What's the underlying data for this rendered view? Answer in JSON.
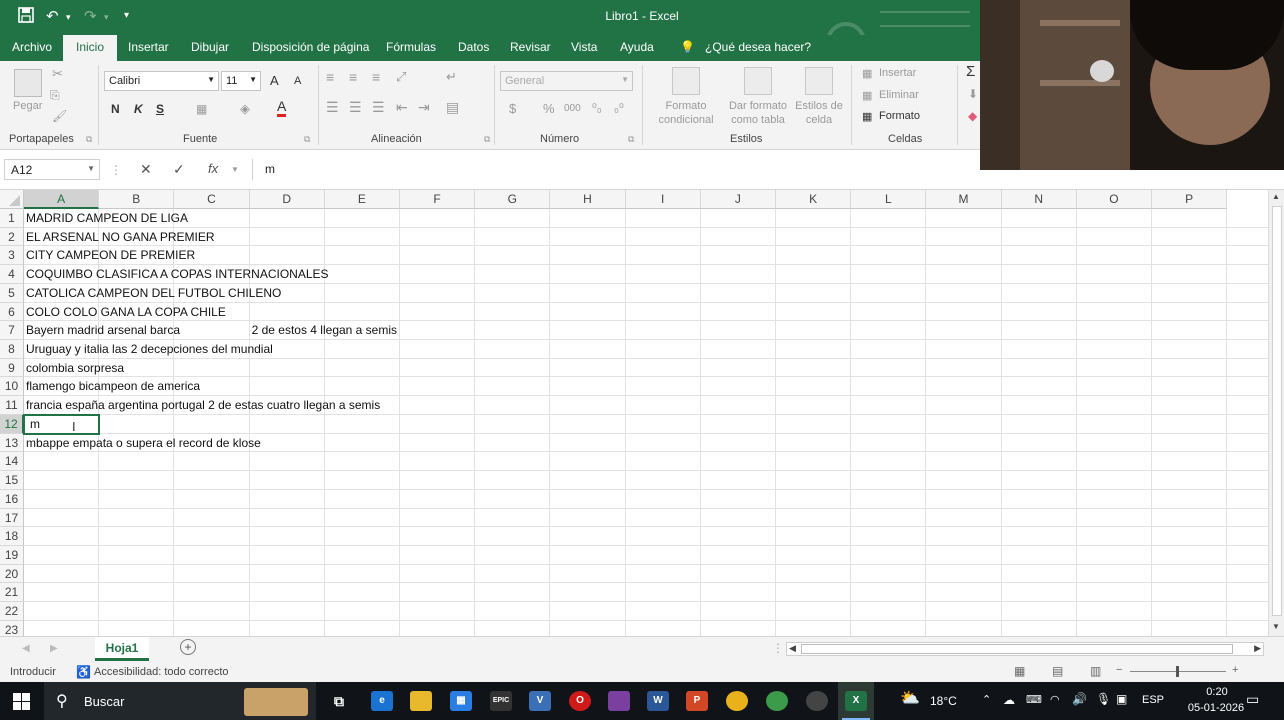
{
  "window": {
    "title": "Libro1  -  Excel"
  },
  "tabs": [
    "Archivo",
    "Inicio",
    "Insertar",
    "Dibujar",
    "Disposición de página",
    "Fórmulas",
    "Datos",
    "Revisar",
    "Vista",
    "Ayuda"
  ],
  "tell_me": "¿Qué desea hacer?",
  "ribbon": {
    "clipboard": {
      "paste": "Pegar",
      "group": "Portapapeles"
    },
    "font": {
      "name": "Calibri",
      "size": "11",
      "bold": "N",
      "italic": "K",
      "underline": "S",
      "grow": "A",
      "shrink": "A",
      "group": "Fuente"
    },
    "alignment": {
      "group": "Alineación"
    },
    "number": {
      "format": "General",
      "group": "Número",
      "currency": "$",
      "percent": "%",
      "thousands": "000"
    },
    "styles": {
      "cond": "Formato condicional",
      "table": "Dar formato como tabla",
      "cell": "Estilos de celda",
      "group": "Estilos"
    },
    "cells": {
      "insert": "Insertar",
      "delete": "Eliminar",
      "format": "Formato",
      "group": "Celdas"
    }
  },
  "formula_bar": {
    "name_box": "A12",
    "fx": "fx",
    "content": "m"
  },
  "columns": [
    "A",
    "B",
    "C",
    "D",
    "E",
    "F",
    "G",
    "H",
    "I",
    "J",
    "K",
    "L",
    "M",
    "N",
    "O",
    "P"
  ],
  "rows": [
    "1",
    "2",
    "3",
    "4",
    "5",
    "6",
    "7",
    "8",
    "9",
    "10",
    "11",
    "12",
    "13",
    "14",
    "15",
    "16",
    "17",
    "18",
    "19",
    "20",
    "21",
    "22",
    "23"
  ],
  "cells": [
    {
      "ref": "A1",
      "col": "A",
      "row": 1,
      "text": "MADRID CAMPEON DE LIGA"
    },
    {
      "ref": "A2",
      "col": "A",
      "row": 2,
      "text": "EL ARSENAL NO GANA PREMIER"
    },
    {
      "ref": "A3",
      "col": "A",
      "row": 3,
      "text": "CITY CAMPEON DE PREMIER"
    },
    {
      "ref": "A4",
      "col": "A",
      "row": 4,
      "text": "COQUIMBO CLASIFICA A COPAS INTERNACIONALES"
    },
    {
      "ref": "A5",
      "col": "A",
      "row": 5,
      "text": "CATOLICA CAMPEON DEL FUTBOL CHILENO"
    },
    {
      "ref": "A6",
      "col": "A",
      "row": 6,
      "text": "COLO COLO GANA LA COPA CHILE"
    },
    {
      "ref": "A7",
      "col": "A",
      "row": 7,
      "text": "Bayern madrid arsenal barca"
    },
    {
      "ref": "D7",
      "col": "D",
      "row": 7,
      "text": "2 de estos 4 llegan a semis"
    },
    {
      "ref": "A8",
      "col": "A",
      "row": 8,
      "text": "Uruguay y italia las 2 decepciones del mundial"
    },
    {
      "ref": "A9",
      "col": "A",
      "row": 9,
      "text": "colombia sorpresa"
    },
    {
      "ref": "A10",
      "col": "A",
      "row": 10,
      "text": "flamengo bicampeon de america"
    },
    {
      "ref": "A11",
      "col": "A",
      "row": 11,
      "text": "francia españa argentina portugal 2 de estas cuatro llegan a semis"
    },
    {
      "ref": "A12",
      "col": "A",
      "row": 12,
      "text": "m"
    },
    {
      "ref": "A13",
      "col": "A",
      "row": 13,
      "text": "mbappe empata o supera el record de klose"
    }
  ],
  "selected_cell": "A12",
  "sheet_tabs": [
    "Hoja1"
  ],
  "status": {
    "mode": "Introducir",
    "accessibility": "Accesibilidad: todo correcto"
  },
  "taskbar": {
    "search_placeholder": "Buscar",
    "weather": "18°C",
    "lang": "ESP",
    "time": "0:20",
    "date": "05-01-2026"
  },
  "colors": {
    "excel_green": "#217346",
    "grid": "#e2e2e2",
    "selection": "#217346"
  }
}
